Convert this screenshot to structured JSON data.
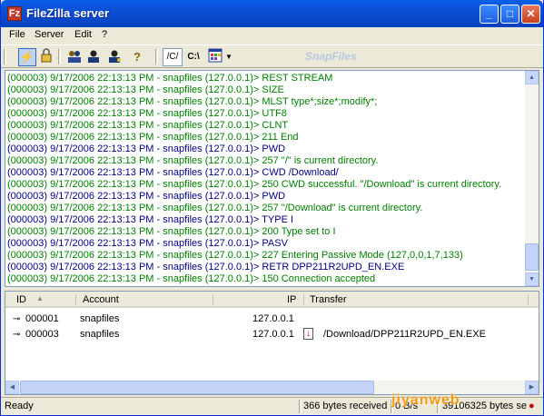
{
  "window": {
    "title": "FileZilla server"
  },
  "titlebar": {
    "app_icon_text": "Fz",
    "min_glyph": "_",
    "max_glyph": "□",
    "close_glyph": "✕"
  },
  "menu": [
    "File",
    "Server",
    "Edit",
    "?"
  ],
  "toolbar": {
    "buttons": [
      {
        "icon": "lightning-icon",
        "glyph": "⚡"
      },
      {
        "icon": "lock-icon",
        "glyph": "🔒"
      },
      {
        "icon": "users-icon",
        "glyph": "👥"
      },
      {
        "icon": "groups-icon",
        "glyph": "👤"
      },
      {
        "icon": "groups-settings-icon",
        "glyph": "👤"
      },
      {
        "icon": "help-icon",
        "glyph": "?"
      }
    ],
    "path_c_slash": "/C/",
    "path_c_backslash": "C:\\",
    "view_icon": "grid-icon"
  },
  "log": {
    "lines": [
      {
        "text": "(000003) 9/17/2006 22:13:13 PM - snapfiles (127.0.0.1)>  REST STREAM",
        "color": "#008000"
      },
      {
        "text": "(000003) 9/17/2006 22:13:13 PM - snapfiles (127.0.0.1)>  SIZE",
        "color": "#008000"
      },
      {
        "text": "(000003) 9/17/2006 22:13:13 PM - snapfiles (127.0.0.1)>  MLST type*;size*;modify*;",
        "color": "#008000"
      },
      {
        "text": "(000003) 9/17/2006 22:13:13 PM - snapfiles (127.0.0.1)>  UTF8",
        "color": "#008000"
      },
      {
        "text": "(000003) 9/17/2006 22:13:13 PM - snapfiles (127.0.0.1)>  CLNT",
        "color": "#008000"
      },
      {
        "text": "(000003) 9/17/2006 22:13:13 PM - snapfiles (127.0.0.1)> 211 End",
        "color": "#008000"
      },
      {
        "text": "(000003) 9/17/2006 22:13:13 PM - snapfiles (127.0.0.1)> PWD",
        "color": "#000080"
      },
      {
        "text": "(000003) 9/17/2006 22:13:13 PM - snapfiles (127.0.0.1)> 257 \"/\" is current directory.",
        "color": "#008000"
      },
      {
        "text": "(000003) 9/17/2006 22:13:13 PM - snapfiles (127.0.0.1)> CWD /Download/",
        "color": "#000080"
      },
      {
        "text": "(000003) 9/17/2006 22:13:13 PM - snapfiles (127.0.0.1)> 250 CWD successful. \"/Download\" is current directory.",
        "color": "#008000"
      },
      {
        "text": "(000003) 9/17/2006 22:13:13 PM - snapfiles (127.0.0.1)> PWD",
        "color": "#000080"
      },
      {
        "text": "(000003) 9/17/2006 22:13:13 PM - snapfiles (127.0.0.1)> 257 \"/Download\" is current directory.",
        "color": "#008000"
      },
      {
        "text": "(000003) 9/17/2006 22:13:13 PM - snapfiles (127.0.0.1)> TYPE I",
        "color": "#000080"
      },
      {
        "text": "(000003) 9/17/2006 22:13:13 PM - snapfiles (127.0.0.1)> 200 Type set to I",
        "color": "#008000"
      },
      {
        "text": "(000003) 9/17/2006 22:13:13 PM - snapfiles (127.0.0.1)> PASV",
        "color": "#000080"
      },
      {
        "text": "(000003) 9/17/2006 22:13:13 PM - snapfiles (127.0.0.1)> 227 Entering Passive Mode (127,0,0,1,7,133)",
        "color": "#008000"
      },
      {
        "text": "(000003) 9/17/2006 22:13:13 PM - snapfiles (127.0.0.1)> RETR DPP211R2UPD_EN.EXE",
        "color": "#000080"
      },
      {
        "text": "(000003) 9/17/2006 22:13:13 PM - snapfiles (127.0.0.1)> 150 Connection accepted",
        "color": "#008000"
      }
    ]
  },
  "connections": {
    "columns": {
      "id": "ID",
      "account": "Account",
      "ip": "IP",
      "transfer": "Transfer"
    },
    "rows": [
      {
        "id": "000001",
        "account": "snapfiles",
        "ip": "127.0.0.1",
        "transfer": ""
      },
      {
        "id": "000003",
        "account": "snapfiles",
        "ip": "127.0.0.1",
        "transfer": "/Download/DPP211R2UPD_EN.EXE"
      }
    ]
  },
  "status": {
    "ready": "Ready",
    "received": "366 bytes received",
    "rate": "0 B/s",
    "sent": "39106325 bytes se"
  },
  "watermarks": {
    "snapfiles": "SnapFiles",
    "jiyanweb": "jiyanweb"
  }
}
